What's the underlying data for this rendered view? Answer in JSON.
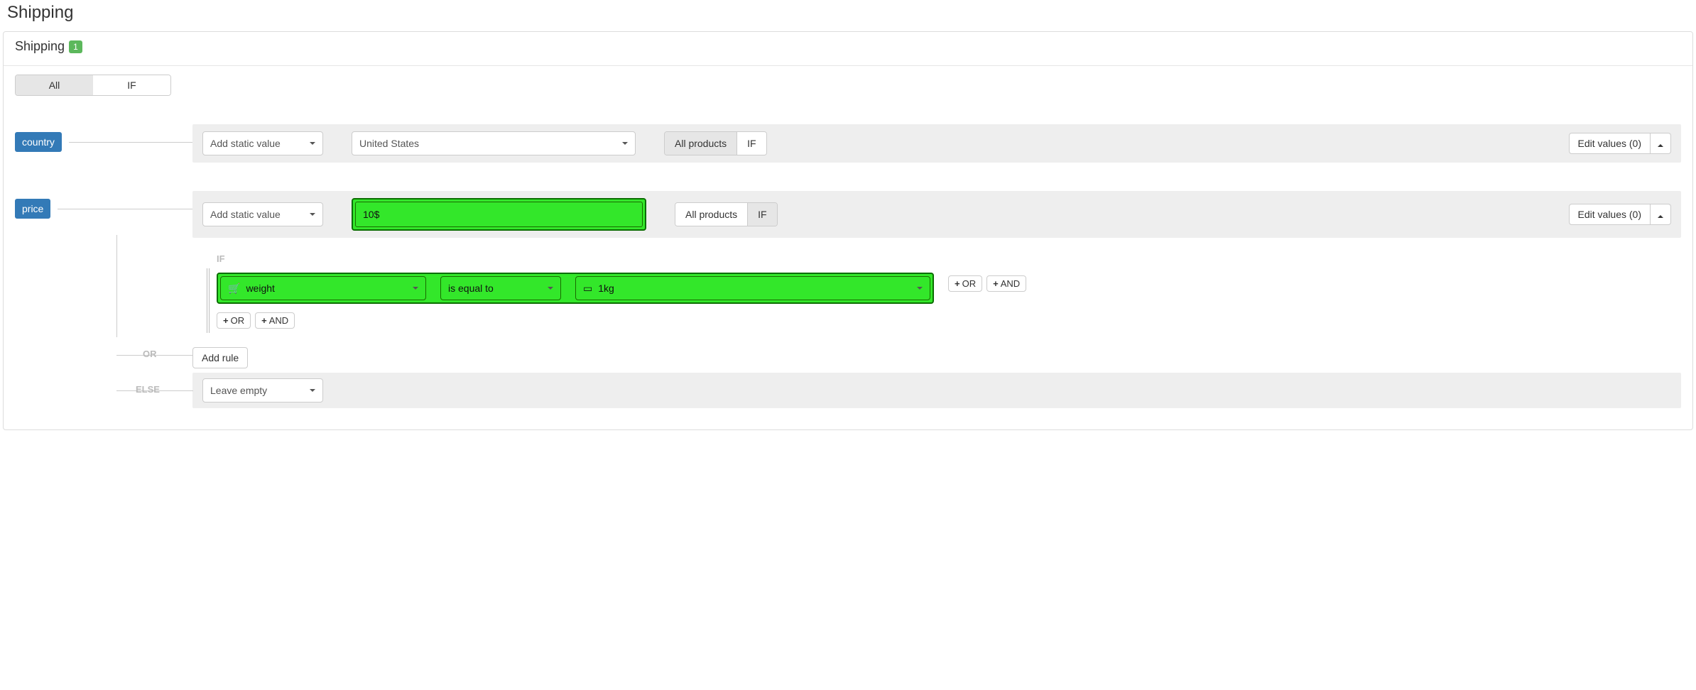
{
  "pageTitle": "Shipping",
  "panel": {
    "title": "Shipping",
    "badge": "1"
  },
  "toggle": {
    "all": "All",
    "if": "IF"
  },
  "countryZone": {
    "tag": "country",
    "addStatic": "Add static value",
    "value": "United States",
    "scope": {
      "all": "All products",
      "if": "IF"
    },
    "edit": "Edit values (0)"
  },
  "priceZone": {
    "tag": "price",
    "addStatic": "Add static value",
    "value": "10$",
    "scope": {
      "all": "All products",
      "if": "IF"
    },
    "edit": "Edit values (0)",
    "ifLabel": "IF",
    "cond": {
      "field": "weight",
      "operator": "is equal to",
      "value": "1kg"
    },
    "or": "OR",
    "and": "AND",
    "orLabel": "OR",
    "addRule": "Add rule",
    "elseLabel": "ELSE",
    "elseAction": "Leave empty"
  }
}
